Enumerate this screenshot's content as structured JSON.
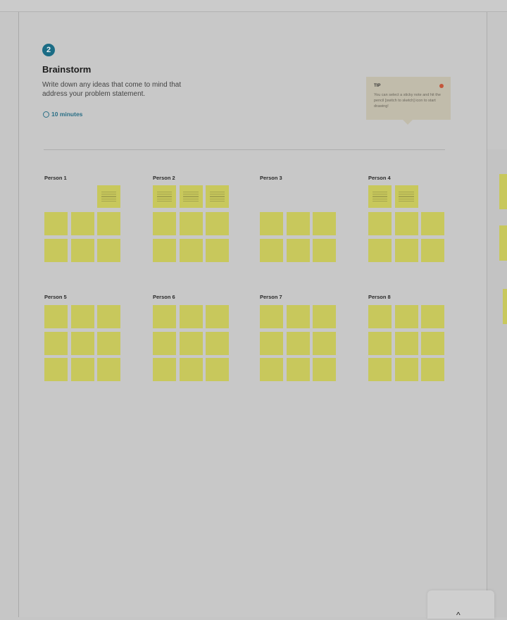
{
  "step": {
    "number": "2",
    "title": "Brainstorm",
    "description": "Write down any ideas that come to mind that address your problem statement.",
    "duration": "10 minutes"
  },
  "tip": {
    "label": "TIP",
    "text": "You can select a sticky note and hit the pencil [switch to sketch] icon to start drawing!"
  },
  "persons": [
    {
      "name": "Person 1",
      "top_notes": [
        false,
        false,
        true
      ]
    },
    {
      "name": "Person 2",
      "top_notes": [
        true,
        true,
        true
      ]
    },
    {
      "name": "Person 3",
      "top_notes": [
        false,
        false,
        false
      ]
    },
    {
      "name": "Person 4",
      "top_notes": [
        true,
        true,
        false
      ]
    },
    {
      "name": "Person 5"
    },
    {
      "name": "Person 6"
    },
    {
      "name": "Person 7"
    },
    {
      "name": "Person 8"
    }
  ],
  "colors": {
    "sticky": "#c8c85c",
    "accent": "#1b6c85"
  }
}
